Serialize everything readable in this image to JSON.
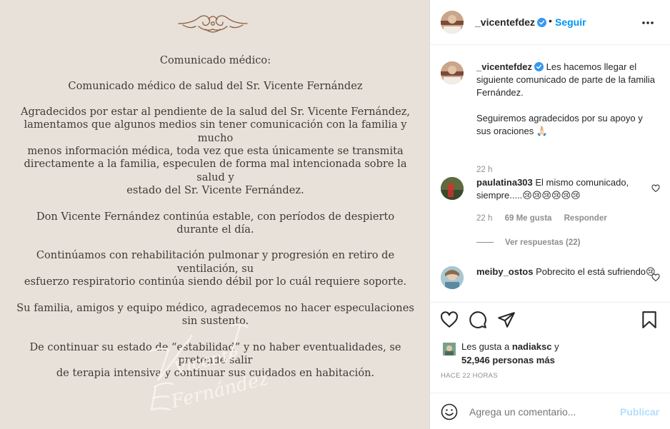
{
  "post_image": {
    "memo_heading": "Comunicado médico:",
    "memo_subheading": "Comunicado médico de salud del Sr. Vicente Fernández",
    "paragraphs": [
      [
        "Agradecidos por estar al pendiente de la salud del Sr. Vicente Fernández,",
        "lamentamos que algunos medios sin tener comunicación con la familia y mucho",
        "menos información médica, toda vez que esta únicamente se transmita",
        "directamente a la familia, especulen de forma mal intencionada sobre la salud y",
        "estado del Sr. Vicente Fernández."
      ],
      [
        "Don Vicente Fernández continúa estable, con períodos de despierto durante el día."
      ],
      [
        "Continúamos con rehabilitación pulmonar y progresión en retiro de ventilación, su",
        "esfuerzo respiratorio continúa siendo débil por lo cuál requiere soporte."
      ],
      [
        "Su familia, amigos y equipo médico, agradecemos no hacer especulaciones",
        "sin sustento."
      ],
      [
        "De continuar su estado de “estabilidad” y no haber eventualidades, se pretende salir",
        "de terapia intensiva y continuar sus cuidados en habitación."
      ]
    ],
    "signature_line1": "Vicente",
    "signature_line2": "Fernández"
  },
  "header": {
    "username": "_vicentefdez",
    "separator": "•",
    "follow_label": "Seguir",
    "more_icon": "more-horizontal-icon"
  },
  "caption": {
    "username": "_vicentefdez",
    "text1": "Les hacemos llegar el siguiente comunicado de parte de la familia Fernández.",
    "text2": "Seguiremos agradecidos por su apoyo y sus oraciones 🙏🏻",
    "time": "22 h"
  },
  "comments": [
    {
      "username": "paulatina303",
      "text": "El mismo comunicado, siempre.....😢😢😢😢😢😢",
      "time": "22 h",
      "likes": "69 Me gusta",
      "reply_label": "Responder",
      "view_replies": "Ver respuestas (22)"
    },
    {
      "username": "meiby_ostos",
      "text": "Pobrecito el está sufriendo😢"
    }
  ],
  "actions": {
    "like_icon": "heart-icon",
    "comment_icon": "comment-icon",
    "share_icon": "send-icon",
    "save_icon": "bookmark-icon"
  },
  "likes": {
    "prefix": "Les gusta a ",
    "user": "nadiaksc",
    "suffix": " y",
    "others": "52,946 personas más"
  },
  "timestamp": "HACE 22 HORAS",
  "comment_box": {
    "placeholder": "Agrega un comentario...",
    "publish_label": "Publicar"
  },
  "colors": {
    "link_blue": "#0095f6",
    "publish_disabled": "#b2dffc",
    "muted": "#8e8e8e",
    "paper": "#e7e1d9"
  }
}
